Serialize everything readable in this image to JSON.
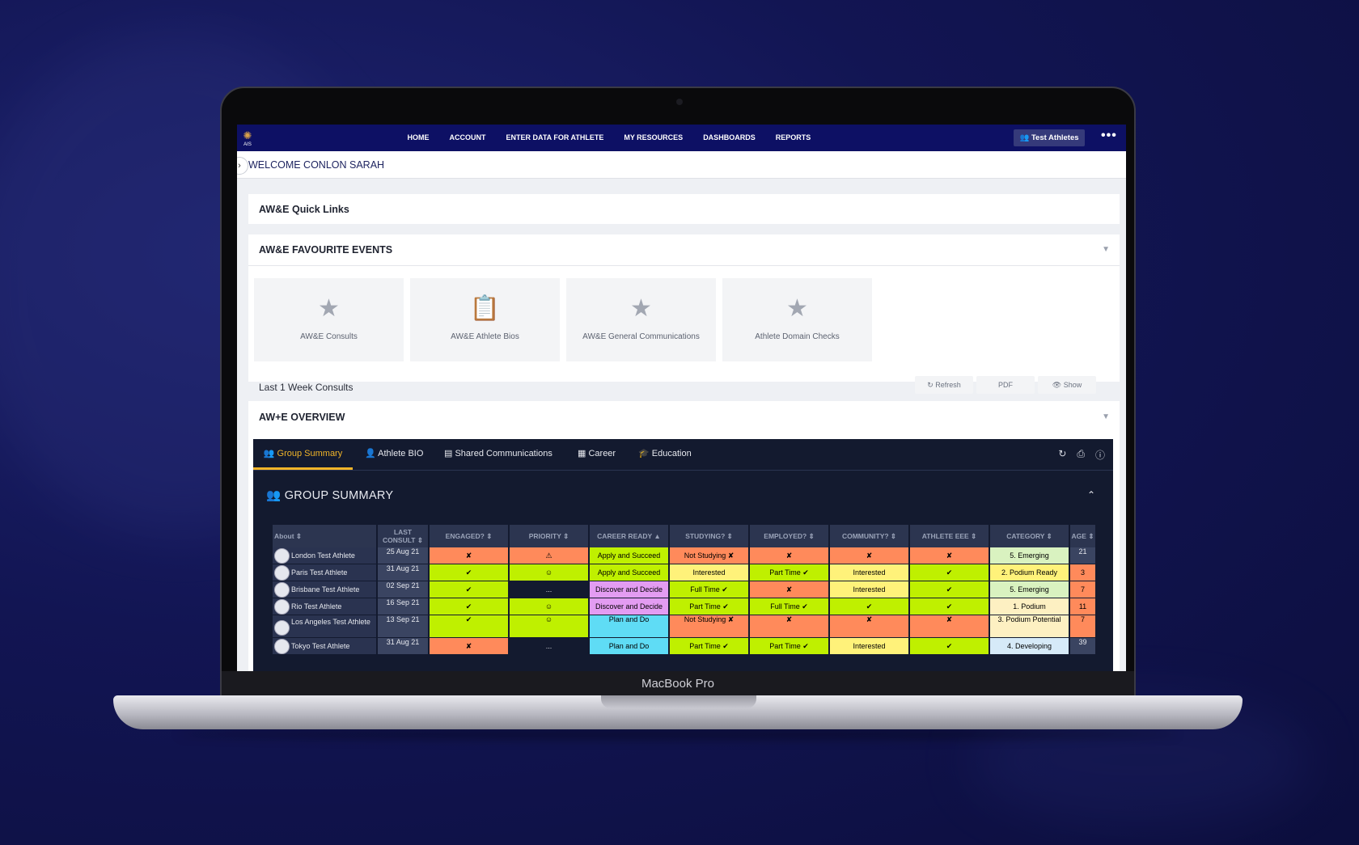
{
  "nav": {
    "logo_text": "AIS",
    "links": [
      "HOME",
      "ACCOUNT",
      "ENTER DATA FOR ATHLETE",
      "MY RESOURCES",
      "DASHBOARDS",
      "REPORTS"
    ],
    "team_button": "Test Athletes",
    "more_icon": "•••"
  },
  "welcome": "WELCOME CONLON SARAH",
  "quick_links": {
    "title": "AW&E Quick Links"
  },
  "favourites": {
    "title": "AW&E FAVOURITE EVENTS",
    "events": [
      {
        "label": "AW&E Consults",
        "icon": "trophy-icon"
      },
      {
        "label": "AW&E Athlete Bios",
        "icon": "clipboard-icon"
      },
      {
        "label": "AW&E General Communications",
        "icon": "trophy-icon"
      },
      {
        "label": "Athlete Domain Checks",
        "icon": "trophy-icon"
      }
    ],
    "last_week": "Last 1 Week Consults",
    "buttons": {
      "refresh": "Refresh",
      "pdf": "PDF",
      "show": "Show"
    }
  },
  "overview": {
    "title": "AW+E OVERVIEW",
    "tabs": [
      "Group Summary",
      "Athlete BIO",
      "Shared Communications",
      "Career",
      "Education"
    ],
    "section_title": "GROUP SUMMARY",
    "columns": [
      "About",
      "LAST CONSULT",
      "ENGAGED?",
      "PRIORITY",
      "CAREER READY",
      "STUDYING?",
      "EMPLOYED?",
      "COMMUNITY?",
      "ATHLETE EEE",
      "CATEGORY",
      "AGE"
    ],
    "rows": [
      {
        "name": "London Test Athlete",
        "date": "25 Aug 21",
        "engaged": "✘",
        "priority": "⚠",
        "career": "Apply and Succeed",
        "studying": "Not Studying ✘",
        "employed": "✘",
        "community": "✘",
        "eee": "✘",
        "category": "5. Emerging",
        "age": "21"
      },
      {
        "name": "Paris Test Athlete",
        "date": "31 Aug 21",
        "engaged": "✔",
        "priority": "☺",
        "career": "Apply and Succeed",
        "studying": "Interested",
        "employed": "Part Time ✔",
        "community": "Interested",
        "eee": "✔",
        "category": "2. Podium Ready",
        "age": "3"
      },
      {
        "name": "Brisbane Test Athlete",
        "date": "02 Sep 21",
        "engaged": "✔",
        "priority": "...",
        "career": "Discover and Decide",
        "studying": "Full Time ✔",
        "employed": "✘",
        "community": "Interested",
        "eee": "✔",
        "category": "5. Emerging",
        "age": "7"
      },
      {
        "name": "Rio Test Athlete",
        "date": "16 Sep 21",
        "engaged": "✔",
        "priority": "☺",
        "career": "Discover and Decide",
        "studying": "Part Time ✔",
        "employed": "Full Time ✔",
        "community": "✔",
        "eee": "✔",
        "category": "1. Podium",
        "age": "11"
      },
      {
        "name": "Los Angeles Test Athlete",
        "date": "13 Sep 21",
        "engaged": "✔",
        "priority": "☺",
        "career": "Plan and Do",
        "studying": "Not Studying ✘",
        "employed": "✘",
        "community": "✘",
        "eee": "✘",
        "category": "3. Podium Potential",
        "age": "7"
      },
      {
        "name": "Tokyo Test Athlete",
        "date": "31 Aug 21",
        "engaged": "✘",
        "priority": "...",
        "career": "Plan and Do",
        "studying": "Part Time ✔",
        "employed": "Part Time ✔",
        "community": "Interested",
        "eee": "✔",
        "category": "4. Developing",
        "age": "39"
      }
    ]
  },
  "device": {
    "label": "MacBook Pro"
  },
  "colors": {
    "nav_bg": "#0d1064",
    "red": "#ff8a5b",
    "green": "#bff000",
    "yellow": "#fff27a",
    "purple": "#e39cf2",
    "cyan": "#5fdcf5",
    "dark": "#131a2f",
    "light_green": "#d9f2c0",
    "peach": "#fdf0c2",
    "light_blue": "#d6eaf8",
    "tab_active": "#f0b429"
  }
}
